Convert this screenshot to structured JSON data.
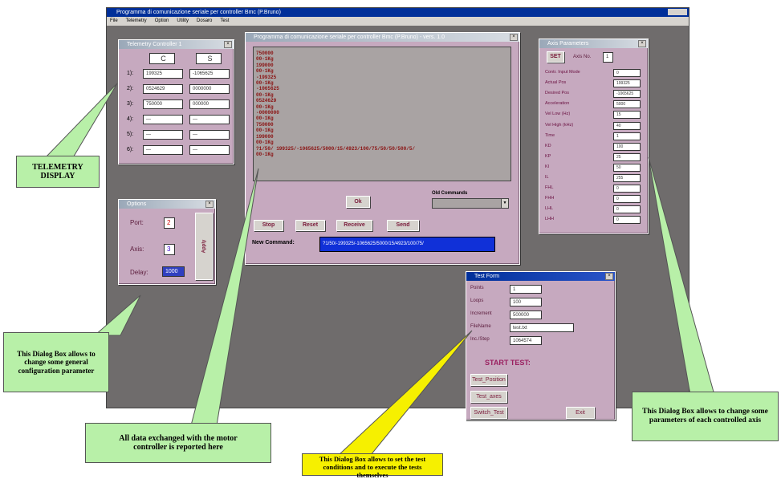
{
  "app": {
    "title": "Programma di comunicazione seriale per controller Bmc (P.Bruno)",
    "menu": [
      "File",
      "Telemetry",
      "Option",
      "Utility",
      "Dosaro",
      "Test"
    ]
  },
  "telemetry": {
    "title": "Telemetry Controller 1",
    "col_headers": [
      "C",
      "S"
    ],
    "rows": [
      {
        "label": "1):",
        "c": "199325",
        "s": "-1065625"
      },
      {
        "label": "2):",
        "c": "0524629",
        "s": "0000000"
      },
      {
        "label": "3):",
        "c": "750000",
        "s": "000000"
      },
      {
        "label": "4):",
        "c": "—",
        "s": "—"
      },
      {
        "label": "5):",
        "c": "—",
        "s": "—"
      },
      {
        "label": "6):",
        "c": "—",
        "s": "—"
      }
    ]
  },
  "options": {
    "title": "Options",
    "port_label": "Port:",
    "port_value": "2",
    "axis_label": "Axis:",
    "axis_value": "3",
    "delay_label": "Delay:",
    "delay_value": "1000",
    "side_button": "Apply"
  },
  "comm": {
    "title": "Programma di comunicazione seriale per controller Bmc (P.Bruno) - vers. 1.0",
    "log": [
      "750000",
      "00-1Kg",
      "199000",
      "00-1Kg",
      "-199325",
      "00-1Kg",
      "-1065625",
      "00-1Kg",
      "0524629",
      "00-1Kg",
      "-0000000",
      "00-1Kg",
      "750000",
      "00-1Kg",
      "199000",
      "00-1Kg",
      "?1/50/ 199325/-1065625/5000/15/4923/100/75/50/50/500/5/",
      "00-1Kg"
    ],
    "ok_label": "Ok",
    "old_commands_label": "Old Commands",
    "buttons": [
      "Stop",
      "Reset",
      "Receive",
      "Send"
    ],
    "new_command_label": "New Command:",
    "new_command_value": "?1/50/-199325/-1065625/5000/15/4923/100/75/"
  },
  "axis": {
    "title": "Axis Parameters",
    "set_label": "SET",
    "axis_no_label": "Axis No.",
    "axis_no_value": "1",
    "params": [
      {
        "name": "Contr. Input Mode",
        "value": "0"
      },
      {
        "name": "Actual Pos",
        "value": "199325"
      },
      {
        "name": "Desired Pos",
        "value": "-1065625"
      },
      {
        "name": "Acceleration",
        "value": "5000"
      },
      {
        "name": "Vel Low (Hz)",
        "value": "15"
      },
      {
        "name": "Vel High (kHz)",
        "value": "40"
      },
      {
        "name": "Time",
        "value": "1"
      },
      {
        "name": "KD",
        "value": "100"
      },
      {
        "name": "KP",
        "value": "25"
      },
      {
        "name": "KI",
        "value": "50"
      },
      {
        "name": "IL",
        "value": "255"
      },
      {
        "name": "FHL",
        "value": "0"
      },
      {
        "name": "FHH",
        "value": "0"
      },
      {
        "name": "LHL",
        "value": "0"
      },
      {
        "name": "LHH",
        "value": "0"
      }
    ]
  },
  "testform": {
    "title": "Test Form",
    "fields": [
      {
        "label": "Points",
        "value": "1"
      },
      {
        "label": "Loops",
        "value": "100"
      },
      {
        "label": "Increment",
        "value": "500000"
      },
      {
        "label": "FileName",
        "value": "test.txt"
      },
      {
        "label": "Inc./Step",
        "value": "1064574"
      }
    ],
    "start_label": "START TEST:",
    "buttons": [
      "Test_Position",
      "Test_axes",
      "Switch_Test"
    ],
    "exit_label": "Exit"
  },
  "callouts": {
    "telemetry": "TELEMETRY DISPLAY",
    "options": "This Dialog Box allows to change some general configuration parameter",
    "comm": "All data exchanged with the motor controller is reported here",
    "test": "This Dialog Box allows to set the test conditions and to execute the tests themselves",
    "axis": "This Dialog Box allows to change some parameters of each controlled axis"
  },
  "colors": {
    "desktop": "#6f6c6c",
    "window": "#c6a9bf",
    "callout_green": "#b8f0a8",
    "callout_yellow": "#f6f000",
    "command_blue": "#1030d8"
  }
}
